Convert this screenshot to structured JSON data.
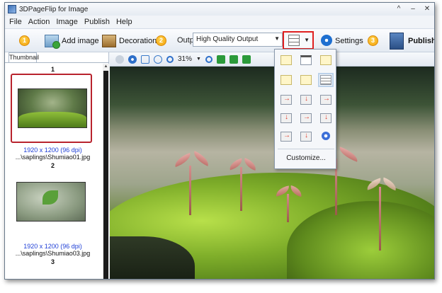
{
  "window": {
    "title": "3DPageFlip for Image",
    "controls": [
      "^",
      "–",
      "✕"
    ]
  },
  "menu": [
    "File",
    "Action",
    "Image",
    "Publish",
    "Help"
  ],
  "toolbar": {
    "steps": [
      "1",
      "2",
      "3"
    ],
    "add_image": "Add image",
    "decoration": "Decoration",
    "output_label": "Output:",
    "output_value": "High Quality Output",
    "settings": "Settings",
    "publish": "Publish"
  },
  "thumbnails": {
    "tab": "Thumbnail",
    "items": [
      {
        "page": "1",
        "dims": "1920 x 1200 (96 dpi)",
        "file": "...\\saplings\\Shumiao01.jpg",
        "selected": true
      },
      {
        "page": "2",
        "dims": "1920 x 1200 (96 dpi)",
        "file": "...\\saplings\\Shumiao03.jpg",
        "selected": false
      },
      {
        "page": "3"
      }
    ]
  },
  "viewer": {
    "zoom": "31%"
  },
  "layout_menu": {
    "customize": "Customize..."
  },
  "colors": {
    "highlight_red": "#e02020",
    "selected_border": "#b8232d",
    "link_blue": "#1f3fd6"
  }
}
